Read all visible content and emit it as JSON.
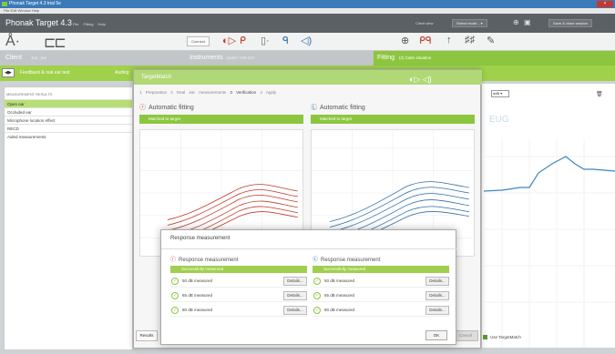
{
  "window": {
    "title": "Phonak Target 4.3 trial 5e",
    "menu": "File  Edit  Window  Help",
    "close_label": "×"
  },
  "app": {
    "brand": "Phonak Target 4.3",
    "menus": "File  Fitting  Help",
    "client_view": "Client view",
    "select_mode": "Select mode... ▾",
    "save_close": "Save & close session"
  },
  "toolbar": {
    "connect": "Connect",
    "instruments": "Instruments"
  },
  "info": {
    "client": "Client",
    "client_name": "Joe, Joe",
    "instruments_label": "Instruments",
    "instruments_value": "Audéo V90-312",
    "fitting": "Fitting",
    "fitting_sub": "(2) Calm situation"
  },
  "subbar": {
    "arrows": "◀▶",
    "feedback": "Feedback & real ear test",
    "audiogram": "Audiog"
  },
  "left": {
    "header": "MEASUREMENT RESULTS",
    "items": [
      "Open ear",
      "Occluded ear",
      "Microphone location effect",
      "RECD",
      "Aided measurements"
    ]
  },
  "right": {
    "select": "ddB ▾",
    "eug": "EUG",
    "trash": "🗑",
    "use_targetmatch": "Use TargetMatch"
  },
  "targetmatch": {
    "title": "TargetMatch",
    "steps": [
      "1 Preparation",
      "2 Real ear measurements",
      "3 Verification",
      "4 Apply"
    ],
    "active_step": "3 Verification",
    "left": {
      "heading": "Automatic fitting",
      "status": "Matched to target"
    },
    "right": {
      "heading": "Automatic fitting",
      "status": "Matched to target"
    },
    "results_btn": "Results",
    "cancel_btn": "Cancel"
  },
  "response": {
    "title": "Response measurement",
    "left": {
      "heading": "Response measurement",
      "status": "Successfully measured",
      "rows": [
        "50 dB measured",
        "65 dB measured",
        "80 dB measured"
      ]
    },
    "right": {
      "heading": "Response measurement",
      "status": "Successfully measured",
      "rows": [
        "50 dB measured",
        "65 dB measured",
        "80 dB measured"
      ]
    },
    "details": "Details...",
    "ok": "OK"
  },
  "colors": {
    "green": "#8cc63f",
    "left_ear": "#c0392b",
    "right_ear": "#2e6ea8"
  }
}
